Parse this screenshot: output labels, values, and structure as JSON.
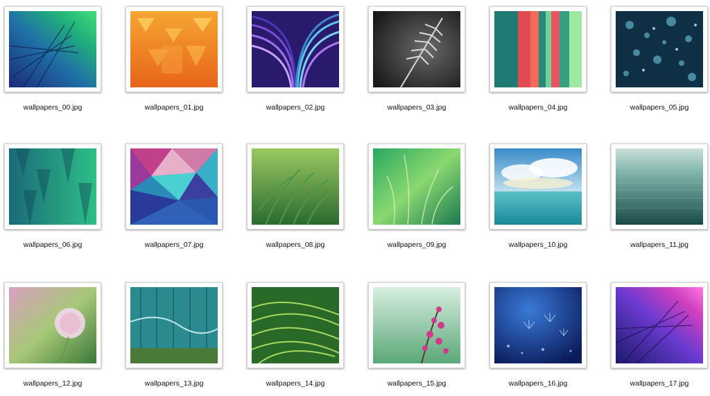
{
  "files": [
    {
      "name": "wallpapers_00.jpg"
    },
    {
      "name": "wallpapers_01.jpg"
    },
    {
      "name": "wallpapers_02.jpg"
    },
    {
      "name": "wallpapers_03.jpg"
    },
    {
      "name": "wallpapers_04.jpg"
    },
    {
      "name": "wallpapers_05.jpg"
    },
    {
      "name": "wallpapers_06.jpg"
    },
    {
      "name": "wallpapers_07.jpg"
    },
    {
      "name": "wallpapers_08.jpg"
    },
    {
      "name": "wallpapers_09.jpg"
    },
    {
      "name": "wallpapers_10.jpg"
    },
    {
      "name": "wallpapers_11.jpg"
    },
    {
      "name": "wallpapers_12.jpg"
    },
    {
      "name": "wallpapers_13.jpg"
    },
    {
      "name": "wallpapers_14.jpg"
    },
    {
      "name": "wallpapers_15.jpg"
    },
    {
      "name": "wallpapers_16.jpg"
    },
    {
      "name": "wallpapers_17.jpg"
    }
  ]
}
